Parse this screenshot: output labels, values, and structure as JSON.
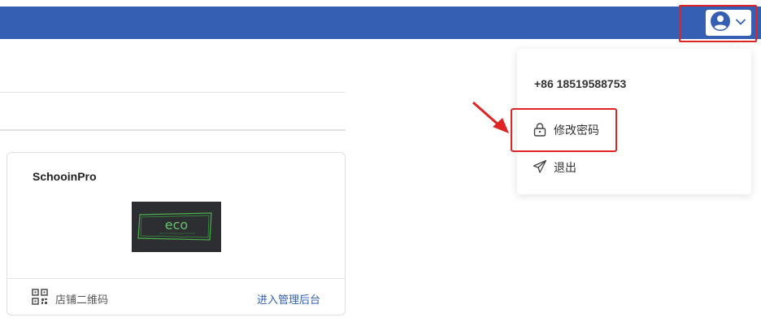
{
  "header": {
    "user_menu_icon": "user-avatar-icon",
    "chevron_icon": "chevron-down-icon"
  },
  "shop_card": {
    "title": "SchooinPro",
    "logo_text": "eco",
    "qr_icon": "qr-code-icon",
    "qr_label": "店铺二维码",
    "admin_link": "进入管理后台"
  },
  "user_dropdown": {
    "phone": "+86 18519588753",
    "items": [
      {
        "label": "修改密码",
        "icon": "lock-icon"
      },
      {
        "label": "退出",
        "icon": "send-icon"
      }
    ]
  },
  "colors": {
    "header": "#355fb3",
    "highlight": "#e02424",
    "link": "#2f5fb3"
  }
}
